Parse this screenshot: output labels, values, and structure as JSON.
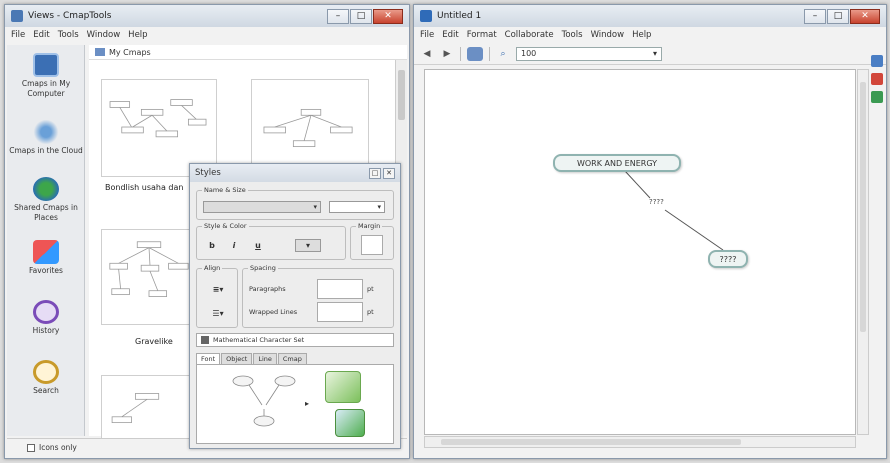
{
  "views_window": {
    "title": "Views - CmapTools",
    "menu": [
      "File",
      "Edit",
      "Tools",
      "Window",
      "Help"
    ],
    "rail": [
      {
        "label": "Cmaps in My Computer",
        "icon": "computer-icon"
      },
      {
        "label": "Cmaps in the Cloud",
        "icon": "cloud-icon"
      },
      {
        "label": "Shared Cmaps in Places",
        "icon": "globe-icon"
      },
      {
        "label": "Favorites",
        "icon": "favorites-icon"
      },
      {
        "label": "History",
        "icon": "history-icon"
      },
      {
        "label": "Search",
        "icon": "search-icon"
      }
    ],
    "folder_title": "My Cmaps",
    "thumbnails": [
      "Bondlish usaha dan",
      "Gravelike"
    ],
    "status_checkbox_label": "Icons only"
  },
  "editor_window": {
    "title": "Untitled 1",
    "menu": [
      "File",
      "Edit",
      "Format",
      "Collaborate",
      "Tools",
      "Window",
      "Help"
    ],
    "zoom": "100",
    "concepts": [
      {
        "label": "WORK AND ENERGY"
      },
      {
        "label": "????"
      }
    ],
    "link_label": "????"
  },
  "styles_dialog": {
    "title": "Styles",
    "font_group": "Name & Size",
    "style_group": "Style & Color",
    "margin_group": "Margin",
    "align_group": "Align",
    "spacing_group": "Spacing",
    "paragraphs_label": "Paragraphs",
    "wrapped_lines_label": "Wrapped Lines",
    "unit": "pt",
    "charset_label": "Mathematical Character Set",
    "tabs": [
      "Font",
      "Object",
      "Line",
      "Cmap"
    ]
  },
  "colors": {
    "concept_border": "#8fb3b0",
    "concept_fill": "#eef4f3",
    "close_button": "#c8432e"
  }
}
